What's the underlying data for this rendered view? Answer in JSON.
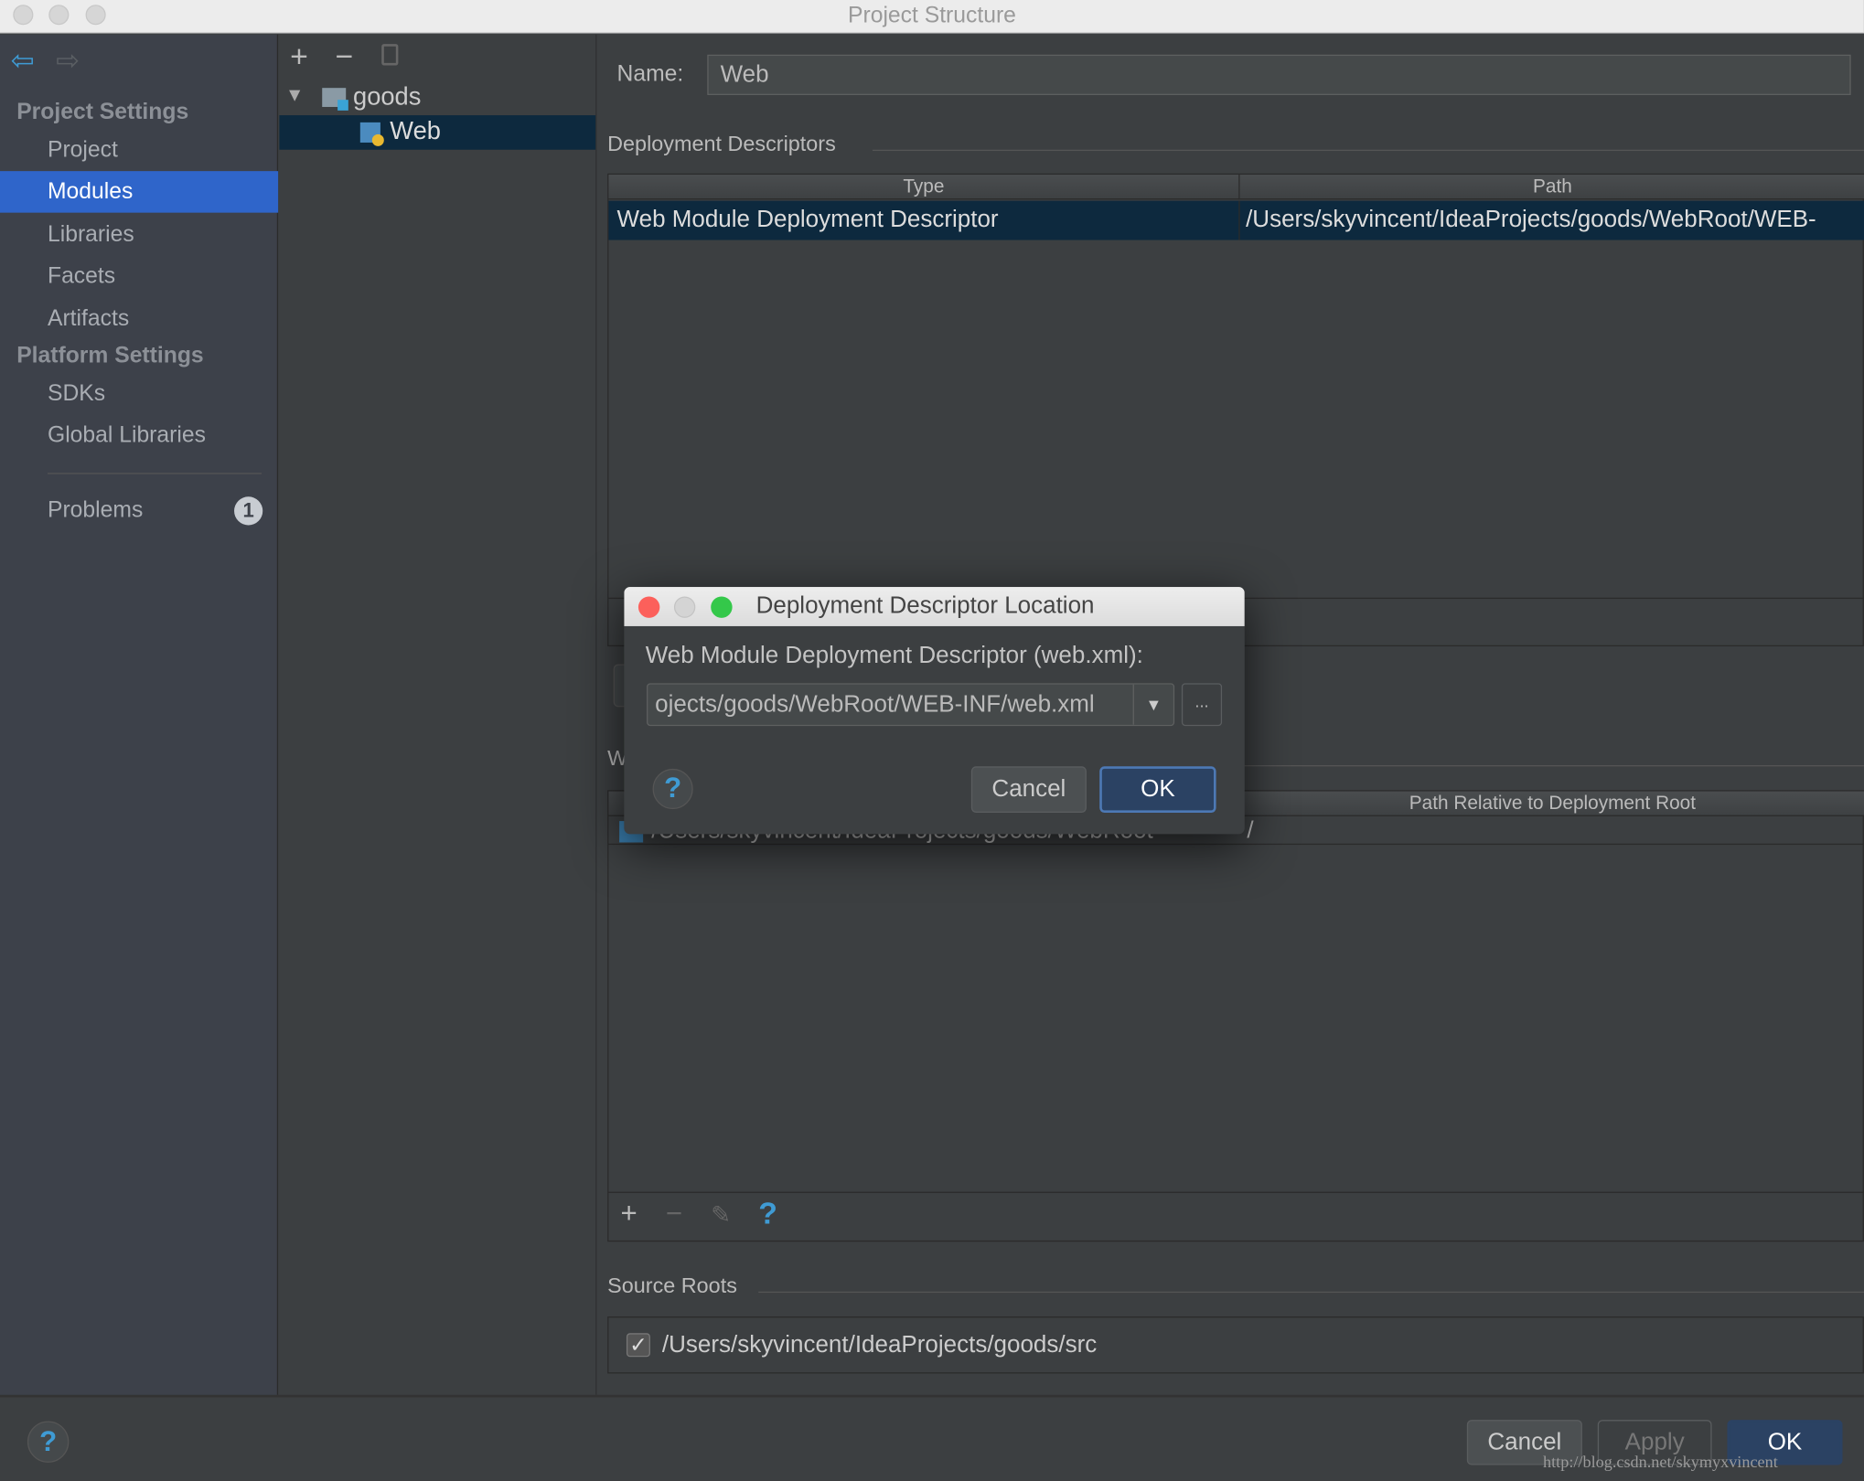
{
  "window": {
    "title": "Project Structure"
  },
  "sidebar": {
    "back_icon": "arrow-left-icon",
    "forward_icon": "arrow-right-icon",
    "project_settings": "Project Settings",
    "items": [
      "Project",
      "Modules",
      "Libraries",
      "Facets",
      "Artifacts"
    ],
    "platform_settings": "Platform Settings",
    "platform_items": [
      "SDKs",
      "Global Libraries"
    ],
    "problems": "Problems",
    "problems_count": "1",
    "selected": "Modules"
  },
  "tree": {
    "root": "goods",
    "child": "Web"
  },
  "main": {
    "name_label": "Name:",
    "name_value": "Web",
    "deployment_descriptors": "Deployment Descriptors",
    "dd_table": {
      "columns": [
        "Type",
        "Path"
      ],
      "rows": [
        [
          "Web Module Deployment Descriptor",
          "/Users/skyvincent/IdeaProjects/goods/WebRoot/WEB-"
        ]
      ]
    },
    "web_resource_title_partial": "W",
    "wr_table": {
      "columns": [
        "",
        "Path Relative to Deployment Root"
      ],
      "rows": [
        [
          "/Users/skyvincent/IdeaProjects/goods/WebRoot",
          "/"
        ]
      ]
    },
    "source_roots": "Source Roots",
    "source_root_path": "/Users/skyvincent/IdeaProjects/goods/src",
    "source_root_checked": true
  },
  "footer": {
    "cancel": "Cancel",
    "apply": "Apply",
    "ok": "OK",
    "watermark": "http://blog.csdn.net/skymyxvincent"
  },
  "dialog": {
    "title": "Deployment Descriptor Location",
    "label": "Web Module Deployment Descriptor (web.xml):",
    "path_value": "ojects/goods/WebRoot/WEB-INF/web.xml",
    "browse": "...",
    "cancel": "Cancel",
    "ok": "OK"
  },
  "colors": {
    "accent": "#2f65ca",
    "selection": "#0d293e",
    "close": "#fc605b",
    "zoom": "#34c84a"
  }
}
